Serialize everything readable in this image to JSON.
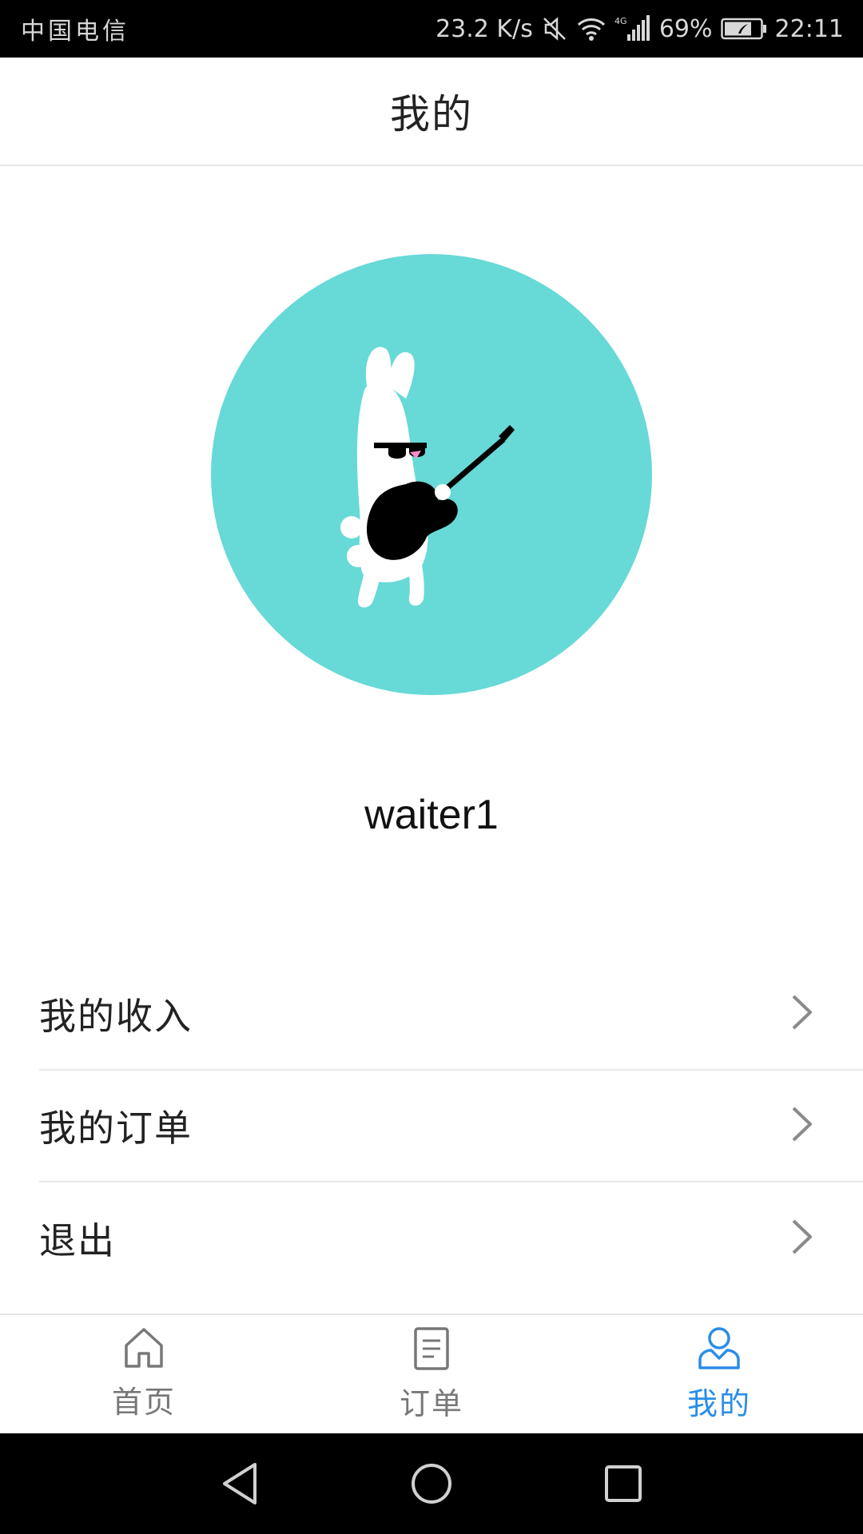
{
  "status_bar": {
    "carrier": "中国电信",
    "net_speed": "23.2 K/s",
    "network_type": "4G",
    "battery": "69%",
    "time": "22:11"
  },
  "header": {
    "title": "我的"
  },
  "profile": {
    "username": "waiter1",
    "avatar_bg": "#67d9d7"
  },
  "menu": {
    "items": [
      {
        "label": "我的收入"
      },
      {
        "label": "我的订单"
      },
      {
        "label": "退出"
      }
    ]
  },
  "tabs": [
    {
      "label": "首页",
      "icon": "home-icon",
      "active": false
    },
    {
      "label": "订单",
      "icon": "document-icon",
      "active": false
    },
    {
      "label": "我的",
      "icon": "user-icon",
      "active": true
    }
  ],
  "colors": {
    "accent": "#2a8de6",
    "inactive": "#777777"
  },
  "nav_bar": {
    "buttons": [
      "back-icon",
      "home-circle-icon",
      "recents-icon"
    ]
  }
}
